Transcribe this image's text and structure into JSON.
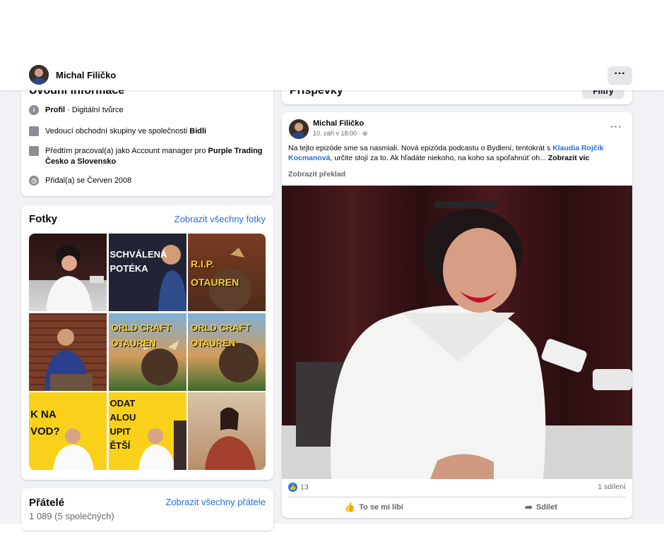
{
  "topbar": {
    "name": "Michal Filičko",
    "more": "···"
  },
  "intro": {
    "title": "Úvodní informace",
    "rows": [
      {
        "icon": "info-icon",
        "prefix": "Profil",
        "text": " · Digitální tvůrce"
      },
      {
        "icon": "briefcase-icon",
        "text": "Vedoucí obchodní skupiny ve společnosti ",
        "bold": "Bidli"
      },
      {
        "icon": "briefcase-icon",
        "text": "Předtím pracoval(a) jako Account manager pro ",
        "bold": "Purple Trading Česko a Slovensko"
      },
      {
        "icon": "clock-icon",
        "text": "Přidal(a) se Červen 2008"
      }
    ]
  },
  "photos": {
    "title": "Fotky",
    "link": "Zobrazit všechny fotky",
    "tiles": [
      {
        "caption": ""
      },
      {
        "caption": "SCHVÁLENÁ POTÉKA"
      },
      {
        "caption": "R.I.P. OTAUREN"
      },
      {
        "caption": ""
      },
      {
        "caption": "ORLD CRAFT OTAUREN"
      },
      {
        "caption": "ORLD CRAFT OTAUREN"
      },
      {
        "caption": "K NA VOD?"
      },
      {
        "caption": "ODAT ALOU UPIT ĚTŠÍ"
      },
      {
        "caption": ""
      }
    ]
  },
  "friends": {
    "title": "Přátelé",
    "link": "Zobrazit všechny přátele",
    "sub": "1 089 (5 společných)"
  },
  "posts_header": {
    "title": "Příspěvky",
    "filters": "Filtry"
  },
  "post": {
    "author": "Michal Filičko",
    "meta": "10. září v 18:00 · ",
    "text_1": "Na tejto epizóde sme sa nasmiali. Nová epizóda podcastu o Bydlení, tentokrát s ",
    "mention": "Klaudia Rojčík Kocmanová",
    "text_2": ", určite stojí za to. Ak hľadáte niekoho, na koho sa spoľahnúť oh... ",
    "see_more": "Zobrazit víc",
    "translate": "Zobrazit překlad",
    "reactions": "13",
    "shares": "1 sdílení",
    "like_label": "To se mi líbí",
    "share_label": "Sdílet"
  },
  "colors": {
    "link": "#216fdb",
    "like": "#1877f2",
    "bg": "#f0f2f5"
  }
}
